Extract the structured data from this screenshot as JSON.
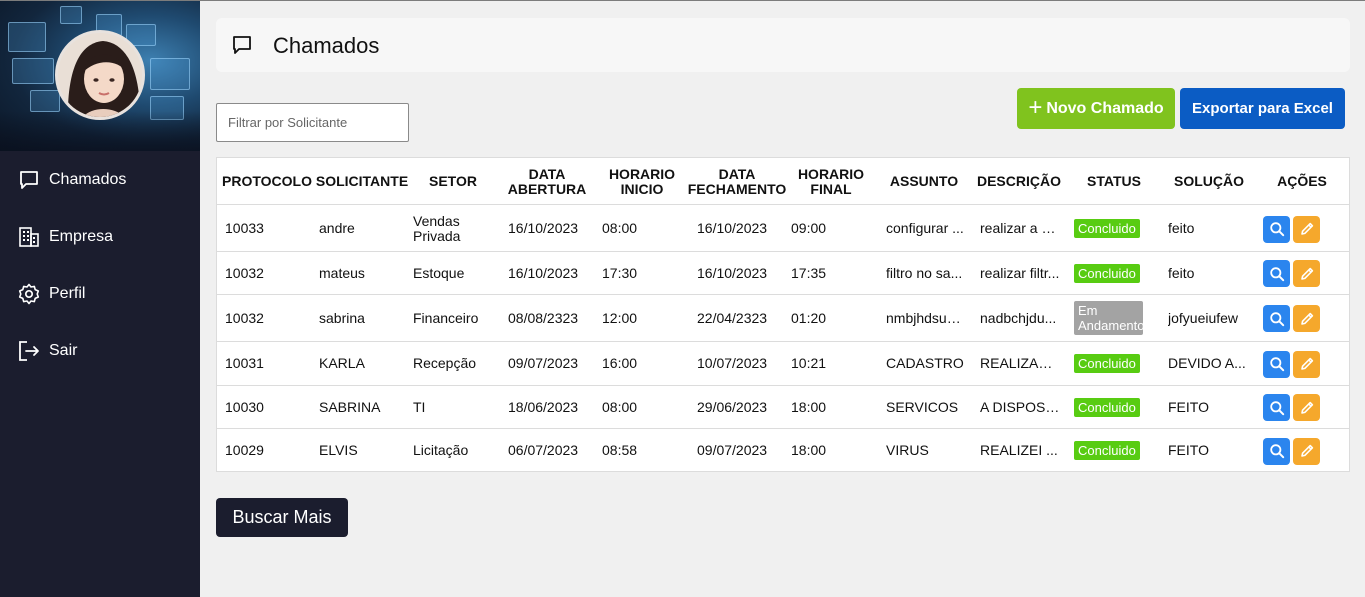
{
  "sidebar": {
    "items": [
      {
        "label": "Chamados",
        "icon": "chat-icon"
      },
      {
        "label": "Empresa",
        "icon": "building-icon"
      },
      {
        "label": "Perfil",
        "icon": "gear-icon"
      },
      {
        "label": "Sair",
        "icon": "logout-icon"
      }
    ]
  },
  "header": {
    "title": "Chamados",
    "icon": "chat-icon"
  },
  "filter": {
    "placeholder": "Filtrar por Solicitante",
    "value": ""
  },
  "toolbar": {
    "new_label": "Novo Chamado",
    "new_icon": "+",
    "export_label": "Exportar para Excel"
  },
  "table": {
    "headers": {
      "protocolo": "PROTOCOLO",
      "solicitante": "SOLICITANTE",
      "setor": "SETOR",
      "data_abertura": "DATA ABERTURA",
      "horario_inicio": "HORARIO INICIO",
      "data_fechamento": "DATA FECHAMENTO",
      "horario_final": "HORARIO FINAL",
      "assunto": "ASSUNTO",
      "descricao": "DESCRIÇÃO",
      "status": "STATUS",
      "solucao": "SOLUÇÃO",
      "acoes": "AÇÕES"
    },
    "rows": [
      {
        "protocolo": "10033",
        "solicitante": "andre",
        "setor": "Vendas Privada",
        "data_abertura": "16/10/2023",
        "horario_inicio": "08:00",
        "data_fechamento": "16/10/2023",
        "horario_final": "09:00",
        "assunto": "configurar ...",
        "descricao": "realizar a c...",
        "status": "Concluido",
        "status_type": "done",
        "solucao": "feito"
      },
      {
        "protocolo": "10032",
        "solicitante": "mateus",
        "setor": "Estoque",
        "data_abertura": "16/10/2023",
        "horario_inicio": "17:30",
        "data_fechamento": "16/10/2023",
        "horario_final": "17:35",
        "assunto": "filtro no sa...",
        "descricao": "realizar filtr...",
        "status": "Concluido",
        "status_type": "done",
        "solucao": "feito"
      },
      {
        "protocolo": "10032",
        "solicitante": "sabrina",
        "setor": "Financeiro",
        "data_abertura": "08/08/2323",
        "horario_inicio": "12:00",
        "data_fechamento": "22/04/2323",
        "horario_final": "01:20",
        "assunto": "nmbjhdsutfdq",
        "descricao": "nadbchjdu...",
        "status": "Em Andamento",
        "status_type": "progress",
        "solucao": "jofyueiufew"
      },
      {
        "protocolo": "10031",
        "solicitante": "KARLA",
        "setor": "Recepção",
        "data_abertura": "09/07/2023",
        "horario_inicio": "16:00",
        "data_fechamento": "10/07/2023",
        "horario_final": "10:21",
        "assunto": "CADASTRO",
        "descricao": "REALIZAR...",
        "status": "Concluido",
        "status_type": "done",
        "solucao": "DEVIDO A..."
      },
      {
        "protocolo": "10030",
        "solicitante": "SABRINA",
        "setor": "TI",
        "data_abertura": "18/06/2023",
        "horario_inicio": "08:00",
        "data_fechamento": "29/06/2023",
        "horario_final": "18:00",
        "assunto": "SERVICOS",
        "descricao": "A DISPOSI...",
        "status": "Concluido",
        "status_type": "done",
        "solucao": "FEITO"
      },
      {
        "protocolo": "10029",
        "solicitante": "ELVIS",
        "setor": "Licitação",
        "data_abertura": "06/07/2023",
        "horario_inicio": "08:58",
        "data_fechamento": "09/07/2023",
        "horario_final": "18:00",
        "assunto": "VIRUS",
        "descricao": "REALIZEI ...",
        "status": "Concluido",
        "status_type": "done",
        "solucao": "FEITO"
      }
    ]
  },
  "footer": {
    "more_label": "Buscar Mais"
  },
  "colors": {
    "sidebar_bg": "#1b1d2e",
    "new_button": "#80c31e",
    "export_button": "#0b5cc4",
    "status_done": "#58cc12",
    "status_progress": "#a3a3a3",
    "view_action": "#2b85ee",
    "edit_action": "#f5a82c"
  }
}
